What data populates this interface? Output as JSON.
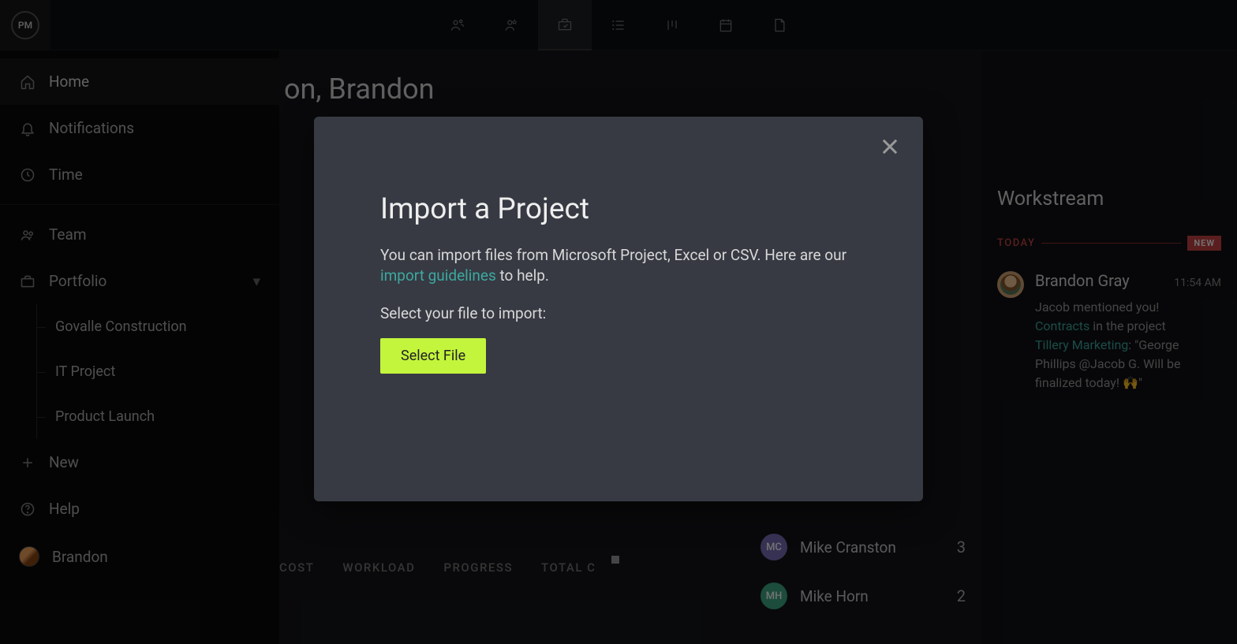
{
  "logo": "PM",
  "sidebar": {
    "home": "Home",
    "notifications": "Notifications",
    "time": "Time",
    "team": "Team",
    "portfolio": "Portfolio",
    "projects": [
      "Govalle Construction",
      "IT Project",
      "Product Launch"
    ],
    "new": "New",
    "help": "Help",
    "user": "Brandon"
  },
  "main": {
    "title_fragment": "on, Brandon",
    "tabs": {
      "cost": "COST",
      "workload": "WORKLOAD",
      "progress": "PROGRESS",
      "total": "TOTAL C"
    },
    "people": [
      {
        "initials": "MC",
        "name": "Mike Cranston",
        "count": "3",
        "color": "#7b6fb8"
      },
      {
        "initials": "MH",
        "name": "Mike Horn",
        "count": "2",
        "color": "#3ea884"
      }
    ]
  },
  "workstream": {
    "title": "Workstream",
    "today": "TODAY",
    "new_badge": "NEW",
    "item": {
      "name": "Brandon Gray",
      "time": "11:54 AM",
      "line1": "Jacob mentioned you!",
      "link1": "Contracts",
      "mid1": " in the project ",
      "link2": "Tillery Marketing",
      "rest": ": \"George Phillips @Jacob G. Will be finalized today! 🙌\""
    }
  },
  "modal": {
    "title": "Import a Project",
    "text_a": "You can import files from Microsoft Project, Excel or CSV. Here are our ",
    "link": "import guidelines",
    "text_b": " to help.",
    "subtext": "Select your file to import:",
    "button": "Select File"
  }
}
